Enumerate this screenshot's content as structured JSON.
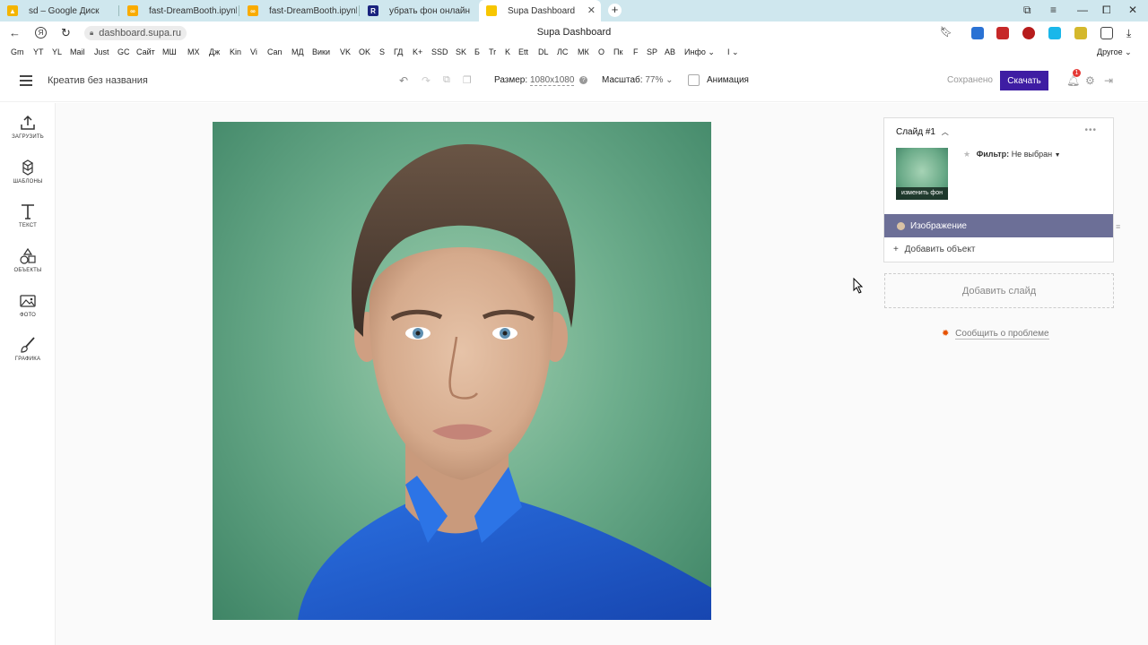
{
  "browser": {
    "tabs": [
      {
        "label": "sd – Google Диск",
        "icon": "google-drive-icon",
        "color": "#f4b400"
      },
      {
        "label": "fast-DreamBooth.ipynb - C",
        "icon": "colab-icon",
        "color": "#f9ab00"
      },
      {
        "label": "fast-DreamBooth.ipynb - C",
        "icon": "colab-icon",
        "color": "#f9ab00"
      },
      {
        "label": "убрать фон онлайн",
        "icon": "r-logo-icon",
        "color": "#1a237e"
      },
      {
        "label": "Supa Dashboard",
        "icon": "duck-icon",
        "color": "#f7c600"
      }
    ],
    "url": "dashboard.supa.ru",
    "page_title": "Supa Dashboard",
    "bookmarks": [
      "Gm",
      "YT",
      "YL",
      "Mail",
      "Just",
      "GC",
      "Сайт",
      "МШ",
      "МХ",
      "Дж",
      "Kin",
      "Vi",
      "Can",
      "МД",
      "Вики",
      "VK",
      "OK",
      "S",
      "ГД",
      "K+",
      "SSD",
      "SK",
      "Б",
      "Tr",
      "K",
      "Ett",
      "DL",
      "ЛС",
      "МК",
      "О",
      "Пк",
      "F",
      "SP",
      "АВ",
      "Инфо ⌄",
      "I ⌄"
    ],
    "other_bookmarks": "Другое ⌄"
  },
  "header": {
    "title": "Креатив без названия",
    "size_label": "Размер:",
    "size_value": "1080x1080",
    "scale_label": "Масштаб:",
    "scale_value": "77% ⌄",
    "animation_label": "Анимация",
    "saved_label": "Сохранено",
    "download_label": "Скачать",
    "notifications_count": "1"
  },
  "sidebar": {
    "items": [
      {
        "label": "ЗАГРУЗИТЬ",
        "icon": "upload-icon"
      },
      {
        "label": "ШАБЛОНЫ",
        "icon": "templates-icon"
      },
      {
        "label": "ТЕКСТ",
        "icon": "text-icon"
      },
      {
        "label": "ОБЪЕКТЫ",
        "icon": "shapes-icon"
      },
      {
        "label": "ФОТО",
        "icon": "photo-icon"
      },
      {
        "label": "ГРАФИКА",
        "icon": "brush-icon"
      }
    ]
  },
  "panel": {
    "slide_title": "Слайд #1",
    "more": "•••",
    "thumb_caption": "изменить фон",
    "filter_label": "Фильтр:",
    "filter_value": "Не выбран",
    "layer_label": "Изображение",
    "add_object": "Добавить объект",
    "add_slide": "Добавить слайд",
    "report": "Сообщить о проблеме"
  },
  "colors": {
    "accent": "#3e1da3",
    "layer_row": "#6c6f97",
    "canvas_bg": "#6eae8d",
    "shirt": "#1e5fd1"
  }
}
